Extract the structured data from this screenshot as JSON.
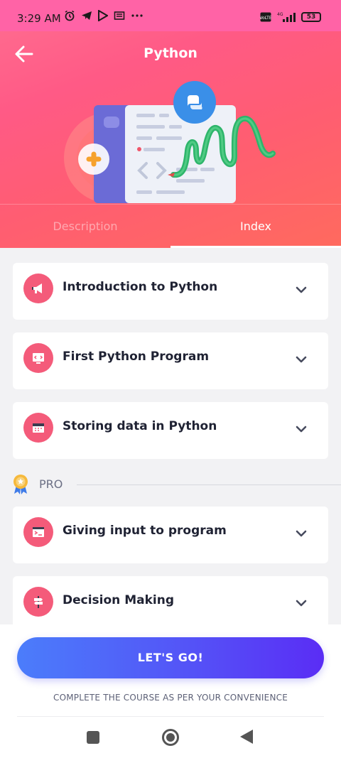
{
  "status_bar": {
    "time": "3:29 AM",
    "battery": "53",
    "network": "4G"
  },
  "header": {
    "title": "Python"
  },
  "tabs": [
    {
      "label": "Description",
      "active": false
    },
    {
      "label": "Index",
      "active": true
    }
  ],
  "lessons": [
    {
      "title": "Introduction to Python",
      "icon": "megaphone-icon"
    },
    {
      "title": "First Python Program",
      "icon": "code-screen-icon"
    },
    {
      "title": "Storing data in Python",
      "icon": "calendar-icon"
    },
    {
      "title": "Giving input to program",
      "icon": "terminal-icon"
    },
    {
      "title": "Decision Making",
      "icon": "signpost-icon"
    }
  ],
  "pro_section": {
    "label": "PRO",
    "icon": "award-badge-icon"
  },
  "footer": {
    "cta_label": "LET'S GO!",
    "subtitle": "COMPLETE THE COURSE AS PER YOUR CONVENIENCE"
  },
  "colors": {
    "hero_gradient_start": "#ff6f91",
    "hero_gradient_end": "#ff6a5e",
    "lesson_icon_bg": "#f45b7a",
    "cta_gradient_start": "#4b7dfb",
    "cta_gradient_end": "#5a2df5"
  }
}
